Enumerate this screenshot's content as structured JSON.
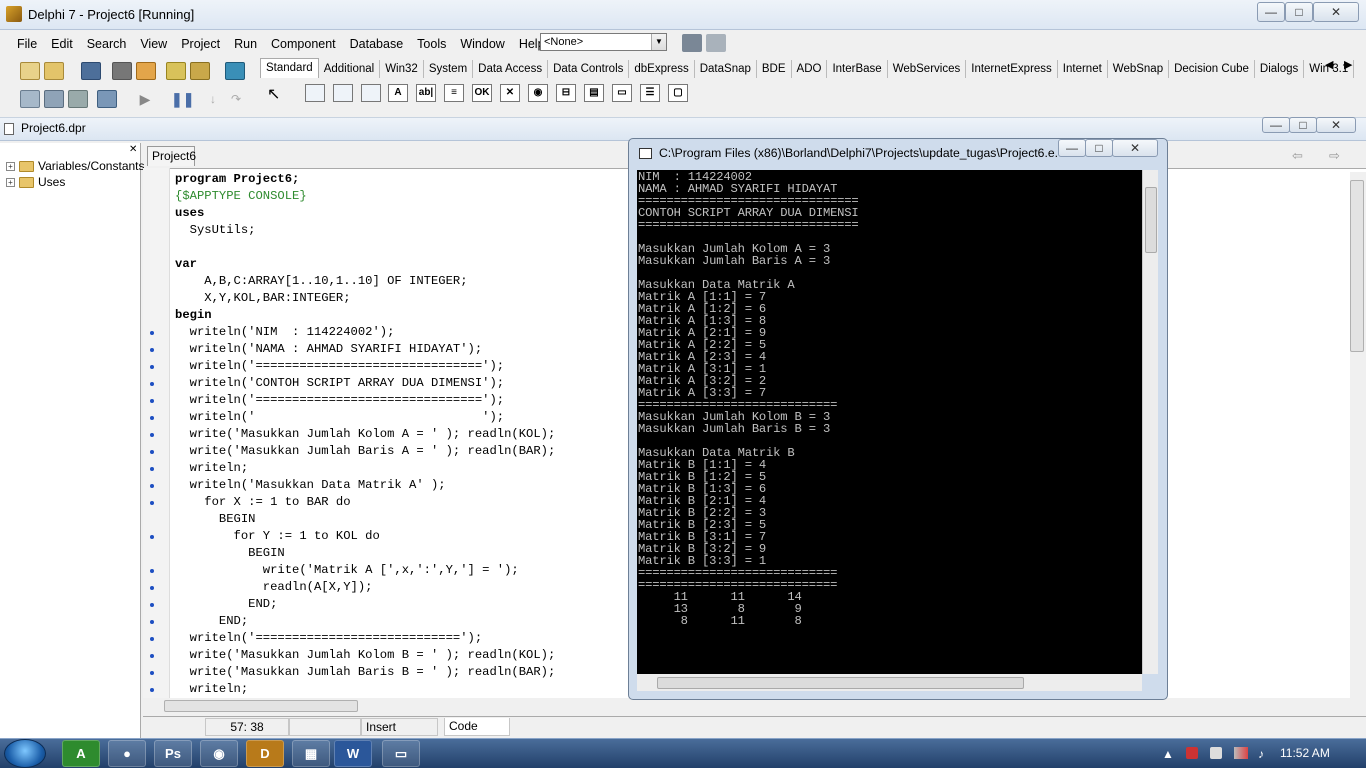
{
  "window": {
    "title": "Delphi 7 - Project6 [Running]",
    "minimize": "—",
    "maximize": "□",
    "close": "✕"
  },
  "menu": [
    "File",
    "Edit",
    "Search",
    "View",
    "Project",
    "Run",
    "Component",
    "Database",
    "Tools",
    "Window",
    "Help"
  ],
  "combo": {
    "value": "<None>"
  },
  "palette_tabs": [
    "Standard",
    "Additional",
    "Win32",
    "System",
    "Data Access",
    "Data Controls",
    "dbExpress",
    "DataSnap",
    "BDE",
    "ADO",
    "InterBase",
    "WebServices",
    "InternetExpress",
    "Internet",
    "WebSnap",
    "Decision Cube",
    "Dialogs",
    "Win 3.1"
  ],
  "palette_icons": [
    "A",
    "ab|",
    "≡",
    "OK",
    "✕",
    "◉",
    "⊟",
    "▤",
    "▭",
    "☰",
    "▢"
  ],
  "project_file": "Project6.dpr",
  "tree": [
    {
      "label": "Variables/Constants"
    },
    {
      "label": "Uses"
    }
  ],
  "editor": {
    "tab": "Project6",
    "lines": [
      "program Project6;",
      "{$APPTYPE CONSOLE}",
      "uses",
      "  SysUtils;",
      "",
      "var",
      "    A,B,C:ARRAY[1..10,1..10] OF INTEGER;",
      "    X,Y,KOL,BAR:INTEGER;",
      "begin",
      "  writeln('NIM  : 114224002');",
      "  writeln('NAMA : AHMAD SYARIFI HIDAYAT');",
      "  writeln('===============================');",
      "  writeln('CONTOH SCRIPT ARRAY DUA DIMENSI');",
      "  writeln('===============================');",
      "  writeln('                               ');",
      "  write('Masukkan Jumlah Kolom A = ' ); readln(KOL);",
      "  write('Masukkan Jumlah Baris A = ' ); readln(BAR);",
      "  writeln;",
      "  writeln('Masukkan Data Matrik A' );",
      "    for X := 1 to BAR do",
      "      BEGIN",
      "        for Y := 1 to KOL do",
      "          BEGIN",
      "            write('Matrik A [',x,':',Y,'] = ');",
      "            readln(A[X,Y]);",
      "          END;",
      "      END;",
      "  writeln('============================');",
      "  write('Masukkan Jumlah Kolom B = ' ); readln(KOL);",
      "  write('Masukkan Jumlah Baris B = ' ); readln(BAR);",
      "  writeln;"
    ]
  },
  "console": {
    "title": "C:\\Program Files (x86)\\Borland\\Delphi7\\Projects\\update_tugas\\Project6.e...",
    "lines": [
      "NIM  : 114224002",
      "NAMA : AHMAD SYARIFI HIDAYAT",
      "===============================",
      "CONTOH SCRIPT ARRAY DUA DIMENSI",
      "===============================",
      "",
      "Masukkan Jumlah Kolom A = 3",
      "Masukkan Jumlah Baris A = 3",
      "",
      "Masukkan Data Matrik A",
      "Matrik A [1:1] = 7",
      "Matrik A [1:2] = 6",
      "Matrik A [1:3] = 8",
      "Matrik A [2:1] = 9",
      "Matrik A [2:2] = 5",
      "Matrik A [2:3] = 4",
      "Matrik A [3:1] = 1",
      "Matrik A [3:2] = 2",
      "Matrik A [3:3] = 7",
      "============================",
      "Masukkan Jumlah Kolom B = 3",
      "Masukkan Jumlah Baris B = 3",
      "",
      "Masukkan Data Matrik B",
      "Matrik B [1:1] = 4",
      "Matrik B [1:2] = 5",
      "Matrik B [1:3] = 6",
      "Matrik B [2:1] = 4",
      "Matrik B [2:2] = 3",
      "Matrik B [2:3] = 5",
      "Matrik B [3:1] = 7",
      "Matrik B [3:2] = 9",
      "Matrik B [3:3] = 1",
      "============================",
      "============================",
      "     11      11      14",
      "     13       8       9",
      "      8      11       8"
    ]
  },
  "status": {
    "position": "57: 38",
    "mode": "Insert",
    "view": "Code"
  },
  "taskbar": {
    "apps": [
      "A",
      "●",
      "Ps",
      "◉",
      "D",
      "▦",
      "W",
      "▭"
    ],
    "clock": "11:52 AM"
  }
}
